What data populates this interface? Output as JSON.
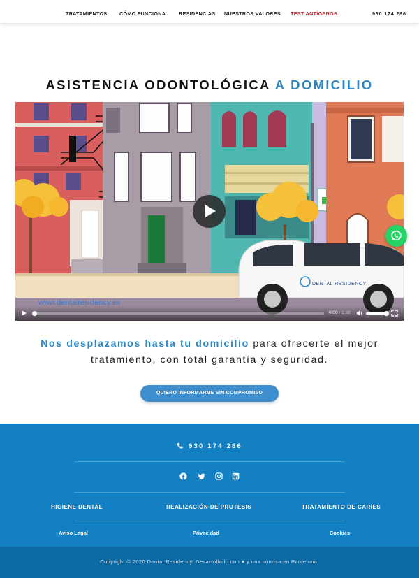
{
  "nav": {
    "items": [
      {
        "label": "TRATAMIENTOS"
      },
      {
        "label": "CÓMO FUNCIONA"
      },
      {
        "label": "RESIDENCIAS"
      },
      {
        "label": "NUESTROS VALORES"
      },
      {
        "label": "TEST ANTÍGENOS"
      }
    ],
    "phone": "930 174 286"
  },
  "hero": {
    "title_main": "ASISTENCIA ODONTOLÓGICA ",
    "title_accent": "A DOMICILIO"
  },
  "video": {
    "watermark": "www.dentalresidency.es",
    "van_brand": "DENTAL RESIDENCY",
    "current_time": "0:00",
    "separator": " / ",
    "duration": "1:38",
    "progress": 0,
    "volume": 1
  },
  "lead": {
    "highlight": "Nos desplazamos hasta tu domicilio",
    "line1_rest": " para ofrecerte el mejor",
    "line2": "tratamiento, con total garantía y seguridad."
  },
  "cta": {
    "label": "QUIERO INFORMARME SIN COMPROMISO"
  },
  "footer": {
    "phone": "930 174 286",
    "social": [
      "facebook-icon",
      "twitter-icon",
      "instagram-icon",
      "linkedin-icon"
    ],
    "services": [
      "HIGIENE DENTAL",
      "REALIZACIÓN DE PROTESIS",
      "TRATAMIENTO DE CARIES"
    ],
    "legal": [
      "Aviso Legal",
      "Privacidad",
      "Cookies"
    ],
    "copyright": "Copyright © 2020 Dental Residency. Desarrollado con ♥ y una sonrisa en Barcelona."
  },
  "colors": {
    "accent": "#2b87c2",
    "nav_highlight": "#c0262d",
    "footer_bg": "#1280c3",
    "copyright_bg": "#0d6aa4",
    "whatsapp": "#25d366"
  }
}
